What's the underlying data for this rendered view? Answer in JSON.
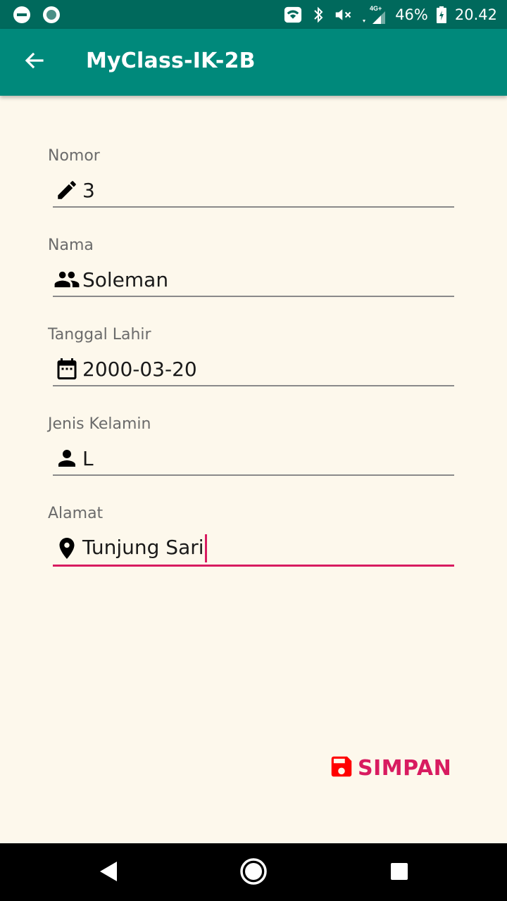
{
  "status_bar": {
    "network_label": "4G+",
    "battery": "46%",
    "time": "20.42",
    "icons": [
      "dnd-icon",
      "sync-icon",
      "wifi-icon",
      "bluetooth-icon",
      "mute-icon",
      "signal-icon",
      "battery-icon"
    ]
  },
  "app_bar": {
    "title": "MyClass-IK-2B",
    "nav_icon": "back-arrow-icon"
  },
  "form": {
    "fields": [
      {
        "label": "Nomor",
        "value": "3",
        "icon": "edit-icon"
      },
      {
        "label": "Nama",
        "value": "Soleman",
        "icon": "people-icon"
      },
      {
        "label": "Tanggal Lahir",
        "value": "2000-03-20",
        "icon": "calendar-icon"
      },
      {
        "label": "Jenis Kelamin",
        "value": "L",
        "icon": "person-icon"
      },
      {
        "label": "Alamat",
        "value": "Tunjung Sari",
        "icon": "location-icon",
        "focused": true
      }
    ]
  },
  "actions": {
    "save_label": "SIMPAN",
    "save_icon": "save-icon"
  },
  "colors": {
    "status_bar": "#00695C",
    "app_bar": "#00897B",
    "background": "#FDF8EC",
    "accent": "#D81B60",
    "save_icon": "#FF0000"
  },
  "navigation": {
    "buttons": [
      "back-triangle-icon",
      "home-circle-icon",
      "recents-square-icon"
    ]
  }
}
